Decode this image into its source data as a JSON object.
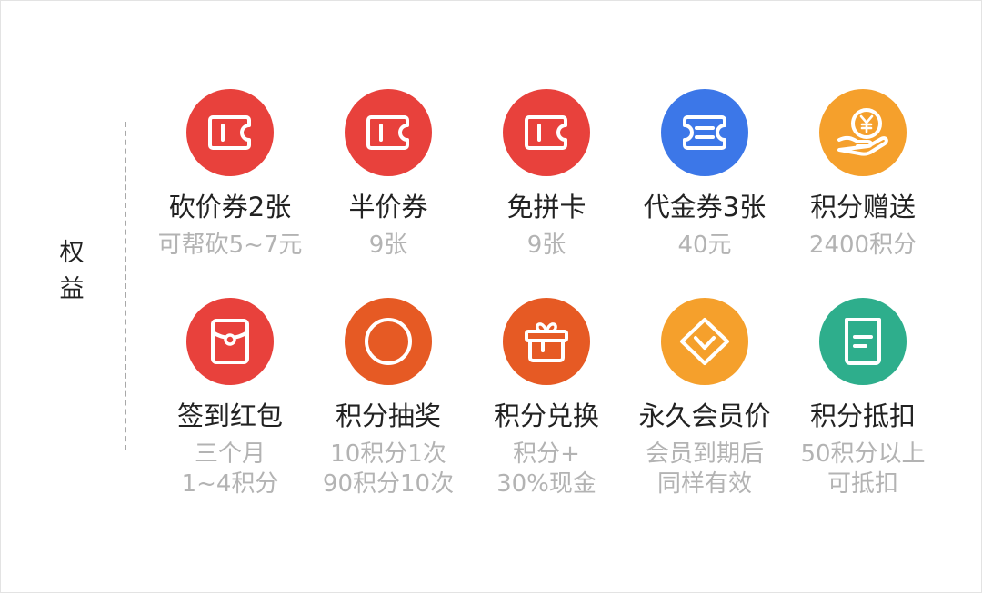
{
  "section_label": [
    "权",
    "益"
  ],
  "benefits": [
    {
      "title": "砍价券2张",
      "desc": [
        "可帮砍5~7元"
      ],
      "icon": "ticket-icon",
      "color": "#e8413c"
    },
    {
      "title": "半价券",
      "desc": [
        "9张"
      ],
      "icon": "ticket-icon",
      "color": "#e8413c"
    },
    {
      "title": "免拼卡",
      "desc": [
        "9张"
      ],
      "icon": "ticket-icon",
      "color": "#e8413c"
    },
    {
      "title": "代金券3张",
      "desc": [
        "40元"
      ],
      "icon": "voucher-icon",
      "color": "#3c77e8"
    },
    {
      "title": "积分赠送",
      "desc": [
        "2400积分"
      ],
      "icon": "coin-hand-icon",
      "color": "#f5a02c"
    },
    {
      "title": "签到红包",
      "desc": [
        "三个月",
        "1~4积分"
      ],
      "icon": "red-envelope-icon",
      "color": "#e8413c"
    },
    {
      "title": "积分抽奖",
      "desc": [
        "10积分1次",
        "90积分10次"
      ],
      "icon": "circle-icon",
      "color": "#e65a24"
    },
    {
      "title": "积分兑换",
      "desc": [
        "积分+",
        "30%现金"
      ],
      "icon": "gift-box-icon",
      "color": "#e65a24"
    },
    {
      "title": "永久会员价",
      "desc": [
        "会员到期后",
        "同样有效"
      ],
      "icon": "diamond-icon",
      "color": "#f5a02c"
    },
    {
      "title": "积分抵扣",
      "desc": [
        "50积分以上",
        "可抵扣"
      ],
      "icon": "document-icon",
      "color": "#2eae8c"
    }
  ]
}
